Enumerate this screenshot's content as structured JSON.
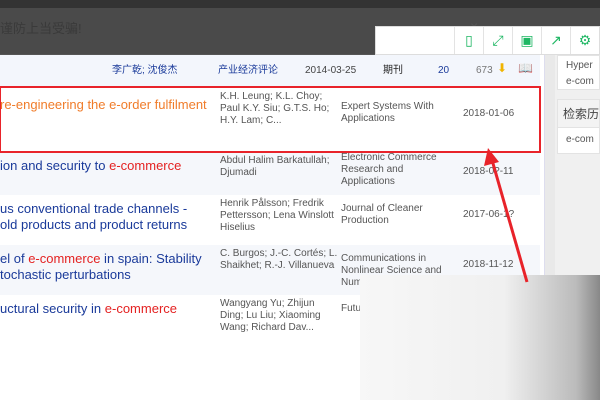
{
  "notice": {
    "text": "谨防上当受骗!",
    "close": "×"
  },
  "toolbar": {
    "icons": [
      "tablet-icon",
      "fullscreen-icon",
      "save-icon",
      "share-icon",
      "settings-icon"
    ],
    "glyphs": [
      "▯",
      "⤢",
      "▣",
      "↗",
      "⚙"
    ]
  },
  "top_row": {
    "authors": "李广乾; 沈俊杰",
    "source": "产业经济评论",
    "date": "2014-03-25",
    "type": "期刊",
    "cited": "20",
    "downloads": "673"
  },
  "rows": [
    {
      "title_pre": "re-engineering the e-order fulfilment",
      "title_hl": "",
      "title_post": "",
      "title2": "",
      "authors": "K.H. Leung; K.L. Choy; Paul K.Y. Siu; G.T.S. Ho; H.Y. Lam; C...",
      "journal": "Expert Systems With Applications",
      "date": "2018-01-06"
    },
    {
      "title_pre": "ion and security to ",
      "title_hl": "e-commerce",
      "title_post": "",
      "title2": "",
      "authors": "Abdul Halim Barkatullah; Djumadi",
      "journal": "Electronic Commerce Research and Applications",
      "date": "2018-0?-11"
    },
    {
      "title_pre": "us conventional trade channels -",
      "title_hl": "",
      "title_post": "",
      "title2": "old products and product returns",
      "authors": "Henrik Pålsson; Fredrik Pettersson; Lena Winslott Hiselius",
      "journal": "Journal of Cleaner Production",
      "date": "2017-06-1?"
    },
    {
      "title_pre": "el of ",
      "title_hl": "e-commerce",
      "title_post": " in spain: Stability",
      "title2": "tochastic perturbations",
      "authors": "C. Burgos; J.-C. Cortés; L. Shaikhet; R.-J. Villanueva",
      "journal": "Communications in Nonlinear Science and Num...",
      "date": "2018-11-12"
    },
    {
      "title_pre": "uctural security in ",
      "title_hl": "e-commerce",
      "title_post": "",
      "title2": "",
      "authors": "Wangyang Yu; Zhijun Ding; Lu Liu; Xiaoming Wang; Richard Dav...",
      "journal": "Futu... Com...",
      "date": ""
    }
  ],
  "sidebar": {
    "items1": [
      "Hyper",
      "e-com"
    ],
    "history_title": "检索历",
    "items2": [
      "e-com"
    ]
  },
  "colors": {
    "highlight_border": "#e8232a",
    "accent_green": "#1fb764",
    "title_blue": "#1a3a9a",
    "highlight_orange": "#f07c2a"
  }
}
